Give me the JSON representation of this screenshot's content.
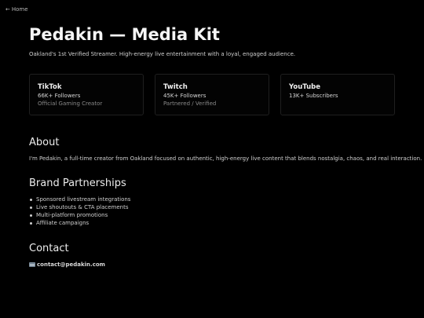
{
  "nav": {
    "home_label": "Home",
    "home_arrow": "←"
  },
  "header": {
    "title": "Pedakin — Media Kit",
    "tagline": "Oakland's 1st Verified Streamer. High-energy live entertainment with a loyal, engaged audience."
  },
  "platforms": [
    {
      "name": "TikTok",
      "followers": "66K+ Followers",
      "note": "Official Gaming Creator"
    },
    {
      "name": "Twitch",
      "followers": "45K+ Followers",
      "note": "Partnered / Verified"
    },
    {
      "name": "YouTube",
      "followers": "13K+ Subscribers",
      "note": ""
    }
  ],
  "about": {
    "heading": "About",
    "text": "I'm Pedakin, a full-time creator from Oakland focused on authentic, high-energy live content that blends nostalgia, chaos, and real interaction."
  },
  "partnerships": {
    "heading": "Brand Partnerships",
    "items": [
      "Sponsored livestream integrations",
      "Live shoutouts & CTA placements",
      "Multi-platform promotions",
      "Affiliate campaigns"
    ]
  },
  "contact": {
    "heading": "Contact",
    "email": "contact@pedakin.com",
    "icon": "envelope-icon"
  },
  "colors": {
    "background": "#000000",
    "text": "#e6e6e6",
    "muted": "#8a8a8a",
    "card_border": "#1f1f1f"
  }
}
